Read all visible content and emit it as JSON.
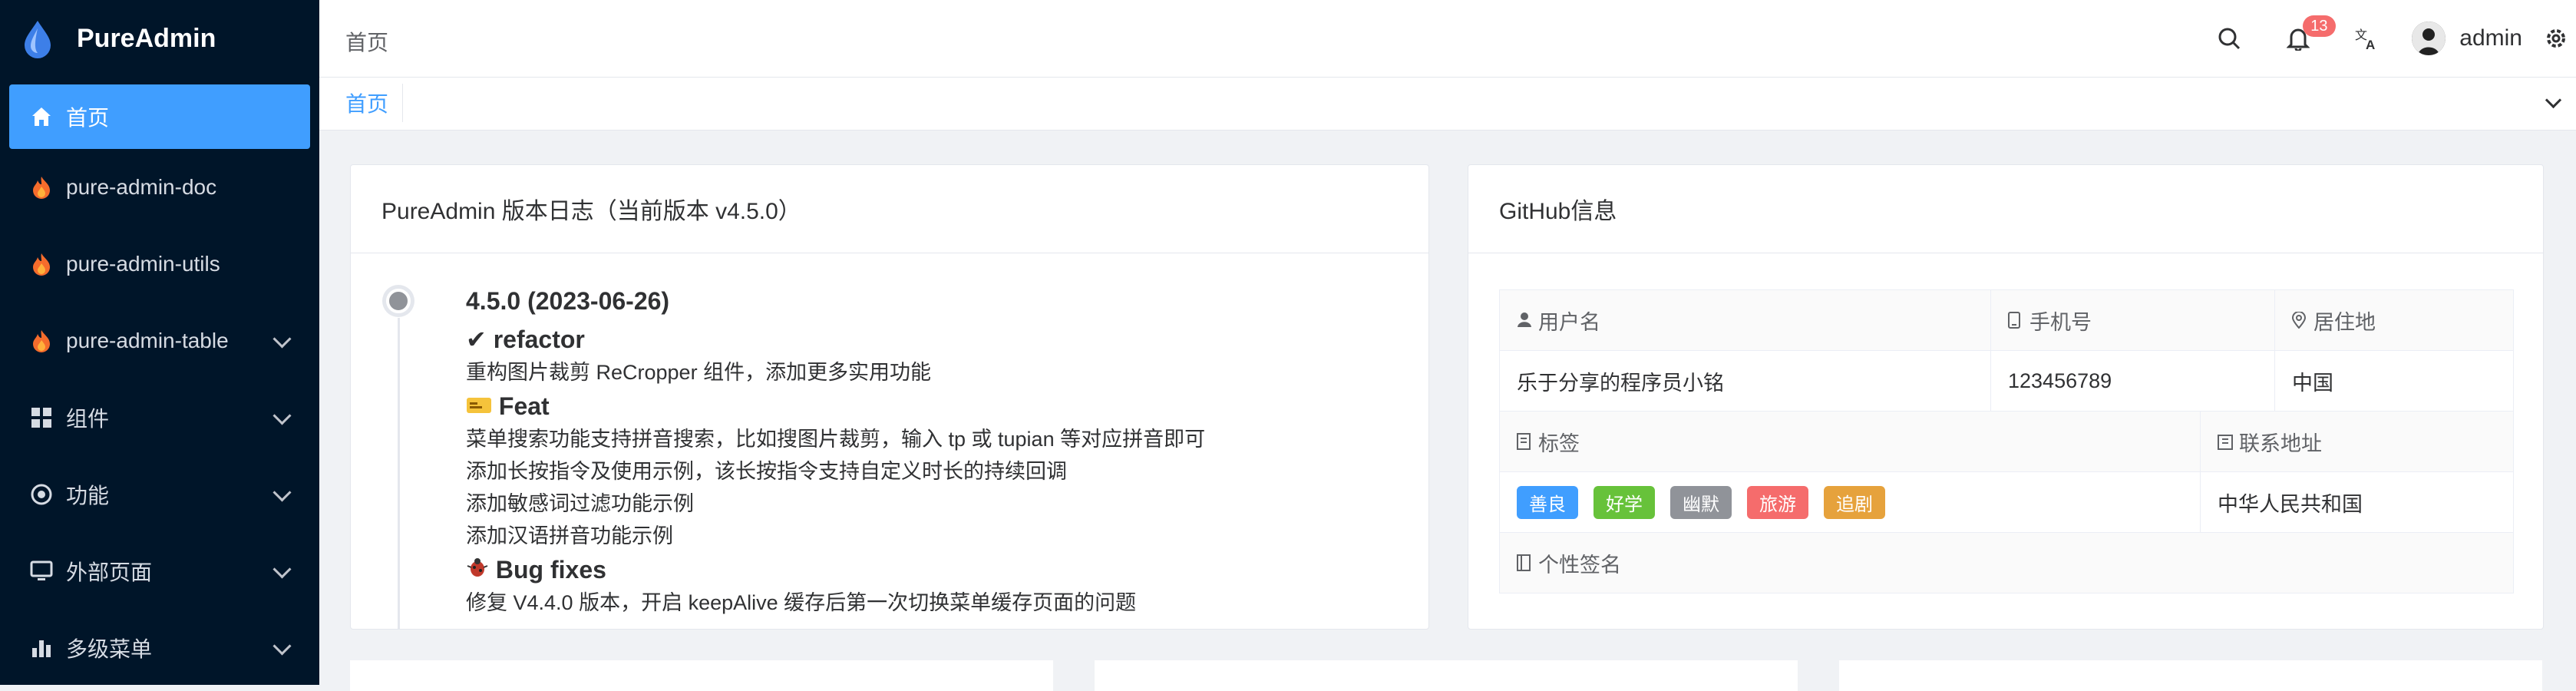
{
  "sidebar": {
    "app_name": "PureAdmin",
    "items": [
      {
        "label": "首页",
        "icon": "home-icon",
        "expandable": false,
        "active": true
      },
      {
        "label": "pure-admin-doc",
        "icon": "fire-icon",
        "expandable": false
      },
      {
        "label": "pure-admin-utils",
        "icon": "fire-icon",
        "expandable": false
      },
      {
        "label": "pure-admin-table",
        "icon": "fire-icon",
        "expandable": true
      },
      {
        "label": "组件",
        "icon": "grid-icon",
        "expandable": true
      },
      {
        "label": "功能",
        "icon": "settings-circle-icon",
        "expandable": true
      },
      {
        "label": "外部页面",
        "icon": "monitor-icon",
        "expandable": true
      },
      {
        "label": "多级菜单",
        "icon": "bar-chart-icon",
        "expandable": true
      }
    ]
  },
  "header": {
    "breadcrumb": "首页",
    "notification_count": "13",
    "username": "admin"
  },
  "tags": {
    "active_tab": "首页"
  },
  "changelog": {
    "title": "PureAdmin 版本日志（当前版本 v4.5.0）",
    "version": "4.5.0 (2023-06-26)",
    "refactor_heading": "✔ refactor",
    "refactor_item": "重构图片裁剪 ReCropper 组件，添加更多实用功能",
    "feat_heading": "Feat",
    "feat_items": [
      "菜单搜索功能支持拼音搜索，比如搜图片裁剪，输入 tp 或 tupian 等对应拼音即可",
      "添加长按指令及使用示例，该长按指令支持自定义时长的持续回调",
      "添加敏感词过滤功能示例",
      "添加汉语拼音功能示例"
    ],
    "bugfix_heading": "Bug fixes",
    "bugfix_partial": "修复 V4.4.0 版本，开启 keepAlive 缓存后第一次切换菜单缓存页面的问题"
  },
  "github": {
    "title": "GitHub信息",
    "labels": {
      "username": "用户名",
      "phone": "手机号",
      "location": "居住地",
      "tags": "标签",
      "address": "联系地址",
      "signature": "个性签名"
    },
    "values": {
      "username": "乐于分享的程序员小铭",
      "phone": "123456789",
      "location": "中国",
      "address": "中华人民共和国"
    },
    "tags": [
      {
        "text": "善良",
        "color": "#409eff"
      },
      {
        "text": "好学",
        "color": "#67c23a"
      },
      {
        "text": "幽默",
        "color": "#909399"
      },
      {
        "text": "旅游",
        "color": "#f56c6c"
      },
      {
        "text": "追剧",
        "color": "#e6a23c"
      }
    ]
  }
}
